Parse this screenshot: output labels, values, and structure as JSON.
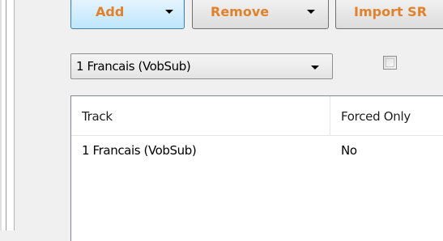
{
  "toolbar": {
    "add_label": "Add",
    "remove_label": "Remove",
    "import_label": "Import SR"
  },
  "track_select": {
    "value": "1 Francais (VobSub)"
  },
  "forced_checkbox": {
    "checked": false
  },
  "track_list": {
    "columns": [
      "Track",
      "Forced Only"
    ],
    "rows": [
      {
        "track": "1 Francais (VobSub)",
        "forced_only": "No"
      }
    ]
  },
  "colors": {
    "button_text": "#e2812b",
    "add_button_border": "#3c7fb1",
    "panel_background": "#f0f0f0",
    "list_background": "#ffffff"
  }
}
